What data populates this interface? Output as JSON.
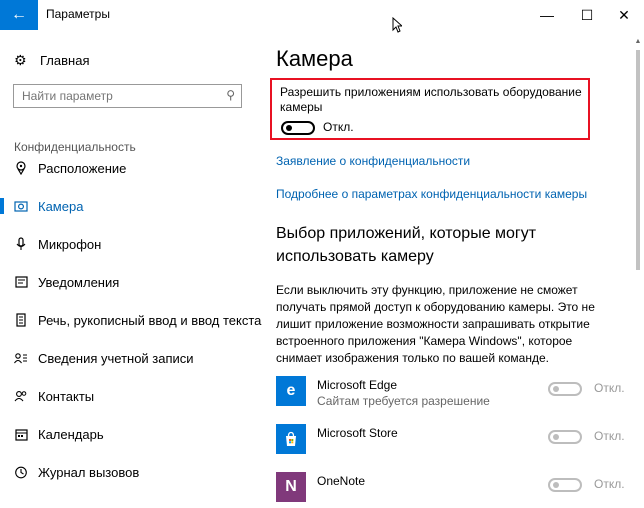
{
  "window": {
    "title": "Параметры",
    "back_icon": "back-arrow-icon",
    "minimize_glyph": "—",
    "maximize_glyph": "☐",
    "close_glyph": "✕",
    "accent": "#0078d7"
  },
  "sidebar": {
    "home_label": "Главная",
    "search_placeholder": "Найти параметр",
    "section": "Конфиденциальность",
    "items": [
      {
        "label": "Расположение",
        "icon": "location-icon"
      },
      {
        "label": "Камера",
        "icon": "camera-icon",
        "active": true
      },
      {
        "label": "Микрофон",
        "icon": "microphone-icon"
      },
      {
        "label": "Уведомления",
        "icon": "notifications-icon"
      },
      {
        "label": "Речь, рукописный ввод и ввод текста",
        "icon": "speech-icon"
      },
      {
        "label": "Сведения учетной записи",
        "icon": "account-info-icon"
      },
      {
        "label": "Контакты",
        "icon": "contacts-icon"
      },
      {
        "label": "Календарь",
        "icon": "calendar-icon"
      },
      {
        "label": "Журнал вызовов",
        "icon": "call-history-icon"
      }
    ]
  },
  "main": {
    "title": "Камера",
    "permission": {
      "text": "Разрешить приложениям использовать оборудование камеры",
      "state": "Откл.",
      "on": false
    },
    "links": [
      "Заявление о конфиденциальности",
      "Подробнее о параметрах конфиденциальности камеры"
    ],
    "apps_heading": "Выбор приложений, которые могут использовать камеру",
    "apps_description": "Если выключить эту функцию, приложение не сможет получать прямой доступ к оборудованию камеры. Это не лишит приложение возможности запрашивать открытие встроенного приложения \"Камера Windows\", которое снимает изображения только по вашей команде.",
    "apps": [
      {
        "name": "Microsoft Edge",
        "sub": "Сайтам требуется разрешение",
        "state": "Откл.",
        "icon": "edge-icon",
        "color": "#0078d7"
      },
      {
        "name": "Microsoft Store",
        "sub": "",
        "state": "Откл.",
        "icon": "store-icon",
        "color": "#0078d7"
      },
      {
        "name": "OneNote",
        "sub": "",
        "state": "Откл.",
        "icon": "onenote-icon",
        "color": "#80397b"
      }
    ]
  }
}
